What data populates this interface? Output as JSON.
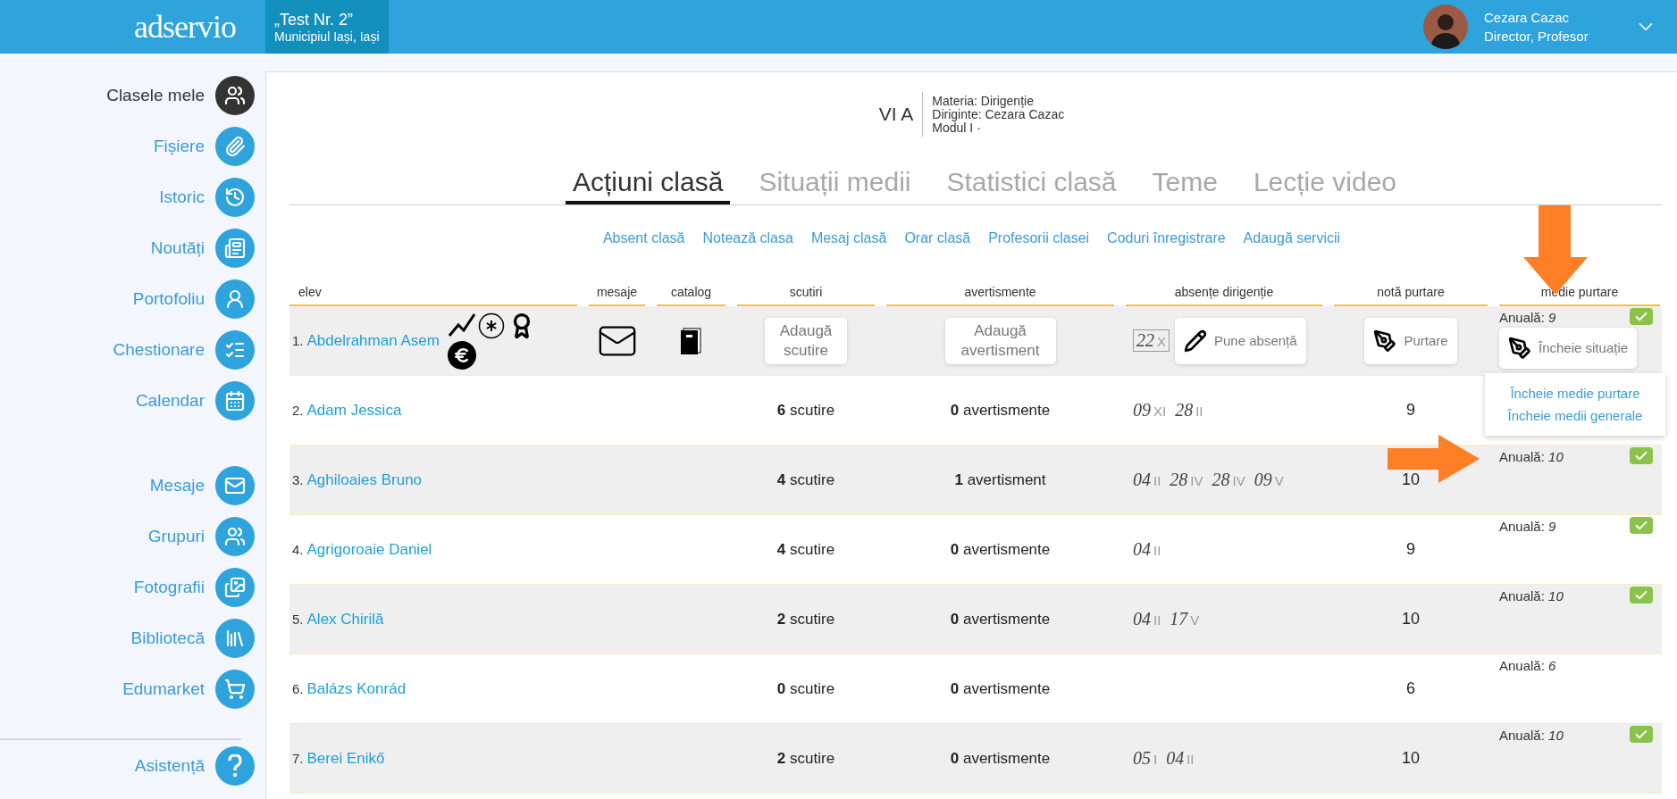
{
  "header": {
    "logo": "adservio",
    "school": {
      "name": "„Test Nr. 2”",
      "place": "Municipiul Iași, Iași"
    },
    "user": {
      "name": "Cezara Cazac",
      "role": "Director, Profesor"
    }
  },
  "sidebar": {
    "sections": [
      {
        "items": [
          {
            "label": "Clasele mele",
            "selected": true
          },
          {
            "label": "Fișiere",
            "selected": false
          },
          {
            "label": "Istoric",
            "selected": false
          },
          {
            "label": "Noutăți",
            "selected": false
          },
          {
            "label": "Portofoliu",
            "selected": false
          },
          {
            "label": "Chestionare",
            "selected": false
          },
          {
            "label": "Calendar",
            "selected": false
          }
        ]
      },
      {
        "items": [
          {
            "label": "Mesaje",
            "selected": false
          },
          {
            "label": "Grupuri",
            "selected": false
          },
          {
            "label": "Fotografii",
            "selected": false
          },
          {
            "label": "Bibliotecă",
            "selected": false
          },
          {
            "label": "Edumarket",
            "selected": false
          }
        ]
      },
      {
        "items": [
          {
            "label": "Asistență",
            "selected": false
          }
        ]
      }
    ]
  },
  "class": {
    "name": "VI A",
    "details": [
      "Materia: Dirigenție",
      "Diriginte: Cezara Cazac",
      "Modul I ·"
    ]
  },
  "tabs": [
    {
      "label": "Acțiuni clasă",
      "selected": true
    },
    {
      "label": "Situații medii",
      "selected": false
    },
    {
      "label": "Statistici clasă",
      "selected": false
    },
    {
      "label": "Teme",
      "selected": false
    },
    {
      "label": "Lecție video",
      "selected": false
    }
  ],
  "actions": [
    "Absent clasă",
    "Notează clasa",
    "Mesaj clasă",
    "Orar clasă",
    "Profesorii clasei",
    "Coduri înregistrare",
    "Adaugă servicii"
  ],
  "table": {
    "columns": [
      "elev",
      "mesaje",
      "catalog",
      "scutiri",
      "avertismente",
      "absențe dirigenție",
      "notă purtare",
      "medie purtare"
    ],
    "rows": [
      {
        "kind": "edit",
        "number": "1.",
        "name": "Abdelrahman Asem",
        "scutiri": "Adaugă scutire",
        "avertismente": "Adaugă avertisment",
        "absences": [
          {
            "day": "22",
            "month": "X"
          }
        ],
        "absence_button": "Pune absență",
        "purtare": "Purtare",
        "medie_button": "Încheie situație",
        "anuala": "Anuală: *9*",
        "confirmed": true,
        "menu": [
          "Încheie medie purtare",
          "Încheie medii generale"
        ]
      },
      {
        "kind": "summary",
        "number": "2.",
        "name": "Adam Jessica",
        "scutiri": "**6** scutire",
        "avertismente": "**0** avertismente",
        "absences": [
          {
            "day": "09",
            "month": "XI"
          },
          {
            "day": "28",
            "month": "II"
          }
        ],
        "purtare": "9"
      },
      {
        "kind": "summary",
        "number": "3.",
        "name": "Aghiloaies Bruno",
        "scutiri": "**4** scutire",
        "avertismente": "**1** avertisment",
        "absences": [
          {
            "day": "04",
            "month": "II"
          },
          {
            "day": "28",
            "month": "IV"
          },
          {
            "day": "28",
            "month": "IV"
          },
          {
            "day": "09",
            "month": "V"
          }
        ],
        "purtare": "10",
        "anuala": "Anuală: *10*",
        "confirmed": true
      },
      {
        "kind": "summary",
        "number": "4.",
        "name": "Agrigoroaie Daniel",
        "scutiri": "**4** scutire",
        "avertismente": "**0** avertismente",
        "absences": [
          {
            "day": "04",
            "month": "II"
          }
        ],
        "purtare": "9",
        "anuala": "Anuală: *9*",
        "confirmed": true
      },
      {
        "kind": "summary",
        "number": "5.",
        "name": "Alex Chirilă",
        "scutiri": "**2** scutire",
        "avertismente": "**0** avertismente",
        "absences": [
          {
            "day": "04",
            "month": "II"
          },
          {
            "day": "17",
            "month": "V"
          }
        ],
        "purtare": "10",
        "anuala": "Anuală: *10*",
        "confirmed": true
      },
      {
        "kind": "summary",
        "number": "6.",
        "name": "Balázs Konrád",
        "scutiri": "**0** scutire",
        "avertismente": "**0** avertismente",
        "absences": [],
        "purtare": "6",
        "anuala": "Anuală: *6*",
        "confirmed": false
      },
      {
        "kind": "summary",
        "number": "7.",
        "name": "Berei Enikő",
        "scutiri": "**2** scutire",
        "avertismente": "**0** avertismente",
        "absences": [
          {
            "day": "05",
            "month": "I"
          },
          {
            "day": "04",
            "month": "II"
          }
        ],
        "purtare": "10",
        "anuala": "Anuală: *10*",
        "confirmed": true
      }
    ]
  }
}
